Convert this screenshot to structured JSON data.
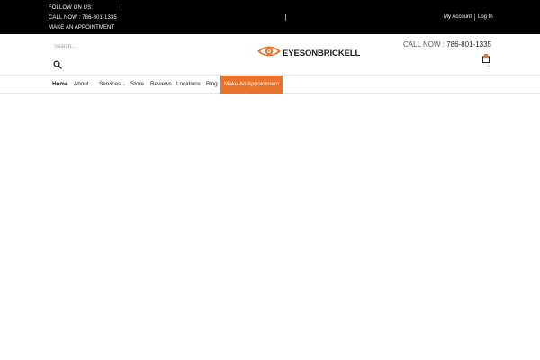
{
  "topbar": {
    "follow_label": "FOLLOW ON US:",
    "call_label": "CALL NOW :  786-801-1335",
    "appointment_label": "MAKE AN APPOINTMENT",
    "my_account": "My Account",
    "log_in": "Log In"
  },
  "header": {
    "search": {
      "placeholder": "Search..."
    },
    "logo_text": "EYESONBRICKELL",
    "call_prefix": "CALL NOW : ",
    "call_number": "786-801-1335",
    "accent_color": "#e8732b"
  },
  "nav": {
    "items": [
      {
        "label": "Home"
      },
      {
        "label": "About"
      },
      {
        "label": "Services"
      },
      {
        "label": "Store"
      },
      {
        "label": "Reviews"
      },
      {
        "label": "Locations"
      },
      {
        "label": "Blog"
      },
      {
        "label": "Make An Appointment"
      }
    ]
  }
}
